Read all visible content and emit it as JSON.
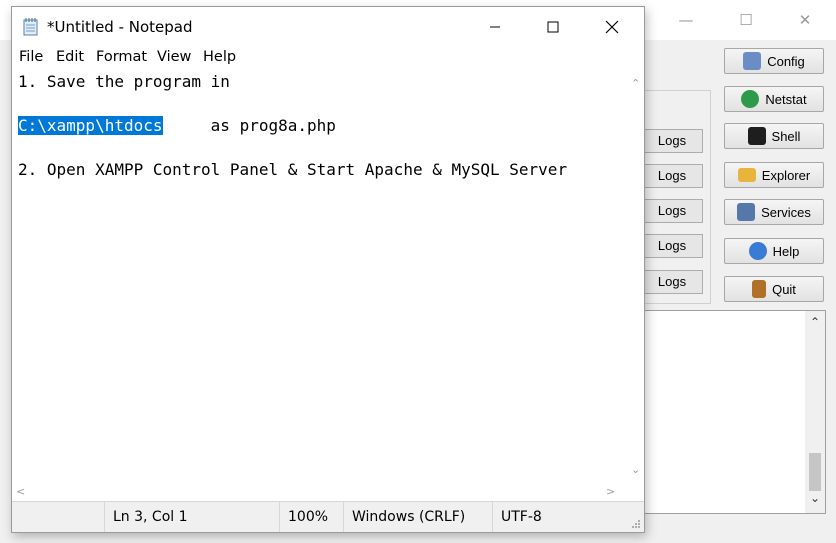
{
  "xampp": {
    "logs_buttons": [
      "Logs",
      "Logs",
      "Logs",
      "Logs",
      "Logs"
    ],
    "side_buttons": [
      {
        "label": "Config",
        "icon": "wrench-icon",
        "color": "#6a8cc7"
      },
      {
        "label": "Netstat",
        "icon": "globe-icon",
        "color": "#2e9b4a"
      },
      {
        "label": "Shell",
        "icon": "terminal-icon",
        "color": "#1e1e1e"
      },
      {
        "label": "Explorer",
        "icon": "folder-icon",
        "color": "#e8b53c"
      },
      {
        "label": "Services",
        "icon": "services-icon",
        "color": "#5577aa"
      },
      {
        "label": "Help",
        "icon": "help-icon",
        "color": "#3a7bd5"
      },
      {
        "label": "Quit",
        "icon": "door-icon",
        "color": "#b0702a"
      }
    ]
  },
  "notepad": {
    "title": "*Untitled - Notepad",
    "menu": [
      "File",
      "Edit",
      "Format",
      "View",
      "Help"
    ],
    "lines": {
      "l1": "1. Save the program in",
      "l2_selected": "C:\\xampp\\htdocs",
      "l2_rest": "     as prog8a.php",
      "l3": "2. Open XAMPP Control Panel & Start Apache & MySQL Server"
    },
    "status": {
      "position": "Ln 3, Col 1",
      "zoom": "100%",
      "line_ending": "Windows (CRLF)",
      "encoding": "UTF-8"
    }
  },
  "colors": {
    "selection": "#0078d7",
    "window_bg": "#f0f0f0"
  }
}
